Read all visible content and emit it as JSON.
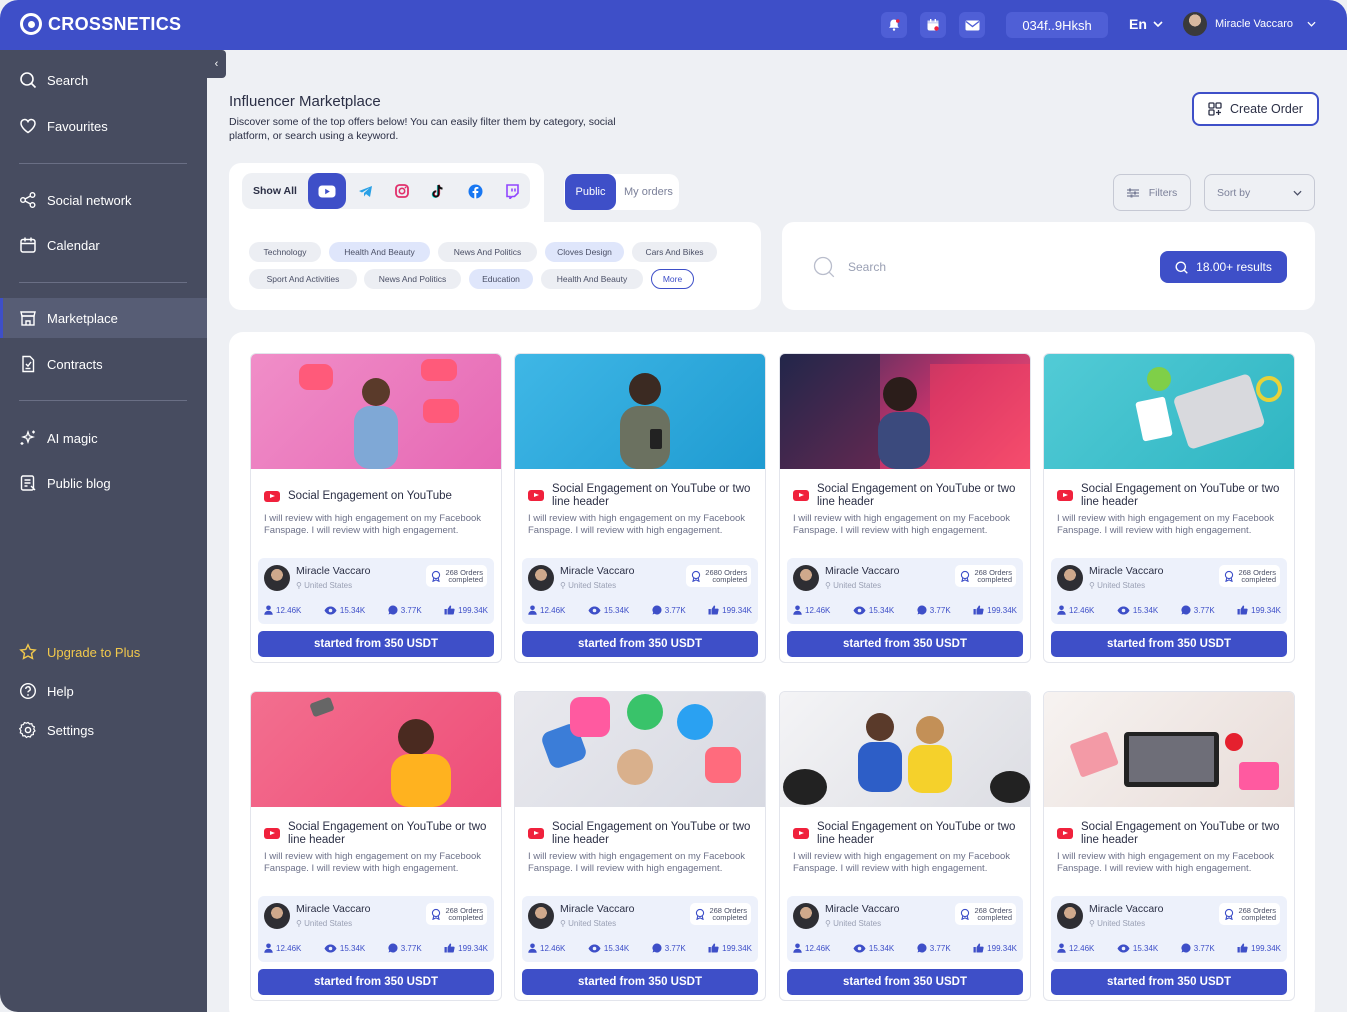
{
  "app": {
    "brand": "CROSSNETICS",
    "wallet": "034f..9Hksh",
    "language": "En",
    "user_name": "Miracle Vaccaro"
  },
  "colors": {
    "accent": "#3e4fc8",
    "sidebar": "#474c60",
    "youtube": "#f0213c",
    "upgrade": "#f2c94c"
  },
  "sidebar": {
    "items": [
      {
        "label": "Search",
        "icon": "search-icon"
      },
      {
        "label": "Favourites",
        "icon": "heart-icon"
      },
      {
        "label": "Social network",
        "icon": "share-icon"
      },
      {
        "label": "Calendar",
        "icon": "calendar-icon"
      },
      {
        "label": "Marketplace",
        "icon": "store-icon"
      },
      {
        "label": "Contracts",
        "icon": "contract-icon"
      },
      {
        "label": "AI magic",
        "icon": "sparkle-icon"
      },
      {
        "label": "Public blog",
        "icon": "blog-icon"
      }
    ],
    "bottom": [
      {
        "label": "Upgrade to Plus",
        "icon": "star-icon"
      },
      {
        "label": "Help",
        "icon": "help-icon"
      },
      {
        "label": "Settings",
        "icon": "gear-icon"
      }
    ],
    "active": "Marketplace"
  },
  "header": {
    "title": "Influencer Marketplace",
    "description": "Discover some of the top offers below! You can easily filter them by category, social platform, or search using a keyword.",
    "create_label": "Create Order"
  },
  "platforms": {
    "show_all": "Show All",
    "icons": [
      "youtube-icon",
      "telegram-icon",
      "instagram-icon",
      "tiktok-icon",
      "facebook-icon",
      "twitch-icon"
    ],
    "selected": "youtube-icon"
  },
  "visibility": {
    "public": "Public",
    "my_orders": "My orders"
  },
  "categories": {
    "row1": [
      "Technology",
      "Health And Beauty",
      "News And Politics",
      "Cloves Design",
      "Cars And Bikes"
    ],
    "row2": [
      "Sport And Activities",
      "News And Politics",
      "Education",
      "Health And Beauty"
    ],
    "more": "More"
  },
  "toolbar": {
    "filters": "Filters",
    "sort": "Sort by"
  },
  "search": {
    "placeholder": "Search",
    "results": "18.00+ results"
  },
  "cards": [
    {
      "title": "Social Engagement on YouTube",
      "desc": "I will review with high engagement on my Facebook Fanspage. I will review with high engagement.",
      "name": "Miracle Vaccaro",
      "location": "United States",
      "orders": "268 Orders",
      "orders_sub": "completed",
      "followers": "12.46K",
      "views": "15.34K",
      "comments": "3.77K",
      "likes": "199.34K",
      "price": "started from 350 USDT"
    },
    {
      "title": "Social Engagement on YouTube or two line header",
      "desc": "I will review with high engagement on my Facebook Fanspage. I will review with high engagement.",
      "name": "Miracle Vaccaro",
      "location": "United States",
      "orders": "2680 Orders",
      "orders_sub": "completed",
      "followers": "12.46K",
      "views": "15.34K",
      "comments": "3.77K",
      "likes": "199.34K",
      "price": "started from 350 USDT"
    },
    {
      "title": "Social Engagement on YouTube or two line header",
      "desc": "I will review with high engagement on my Facebook Fanspage. I will review with high engagement.",
      "name": "Miracle Vaccaro",
      "location": "United States",
      "orders": "268 Orders",
      "orders_sub": "completed",
      "followers": "12.46K",
      "views": "15.34K",
      "comments": "3.77K",
      "likes": "199.34K",
      "price": "started from 350 USDT"
    },
    {
      "title": "Social Engagement on YouTube or two line header",
      "desc": "I will review with high engagement on my Facebook Fanspage. I will review with high engagement.",
      "name": "Miracle Vaccaro",
      "location": "United States",
      "orders": "268 Orders",
      "orders_sub": "completed",
      "followers": "12.46K",
      "views": "15.34K",
      "comments": "3.77K",
      "likes": "199.34K",
      "price": "started from 350 USDT"
    },
    {
      "title": "Social Engagement on YouTube or two line header",
      "desc": "I will review with high engagement on my Facebook Fanspage. I will review with high engagement.",
      "name": "Miracle Vaccaro",
      "location": "United States",
      "orders": "268 Orders",
      "orders_sub": "completed",
      "followers": "12.46K",
      "views": "15.34K",
      "comments": "3.77K",
      "likes": "199.34K",
      "price": "started from 350 USDT"
    },
    {
      "title": "Social Engagement on YouTube or two line header",
      "desc": "I will review with high engagement on my Facebook Fanspage. I will review with high engagement.",
      "name": "Miracle Vaccaro",
      "location": "United States",
      "orders": "268 Orders",
      "orders_sub": "completed",
      "followers": "12.46K",
      "views": "15.34K",
      "comments": "3.77K",
      "likes": "199.34K",
      "price": "started from 350 USDT"
    },
    {
      "title": "Social Engagement on YouTube or two line header",
      "desc": "I will review with high engagement on my Facebook Fanspage. I will review with high engagement.",
      "name": "Miracle Vaccaro",
      "location": "United States",
      "orders": "268 Orders",
      "orders_sub": "completed",
      "followers": "12.46K",
      "views": "15.34K",
      "comments": "3.77K",
      "likes": "199.34K",
      "price": "started from 350 USDT"
    },
    {
      "title": "Social Engagement on YouTube or two line header",
      "desc": "I will review with high engagement on my Facebook Fanspage. I will review with high engagement.",
      "name": "Miracle Vaccaro",
      "location": "United States",
      "orders": "268 Orders",
      "orders_sub": "completed",
      "followers": "12.46K",
      "views": "15.34K",
      "comments": "3.77K",
      "likes": "199.34K",
      "price": "started from 350 USDT"
    }
  ]
}
